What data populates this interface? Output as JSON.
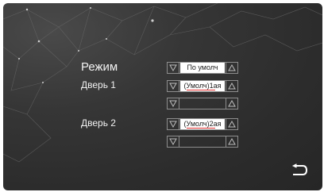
{
  "settings": {
    "mode_label": "Режим",
    "mode_value": "По умолч",
    "door1_label": "Дверь 1",
    "door1_value": "(Умолч)1ая",
    "door1_extra_value": "",
    "door2_label": "Дверь 2",
    "door2_value": "(Умолч)2ая",
    "door2_extra_value": ""
  },
  "icons": {
    "decrease": "triangle-down-icon",
    "increase": "triangle-up-icon",
    "back": "return-arrow-icon"
  },
  "colors": {
    "background": "#2e2e2e",
    "text": "#f2f2f2",
    "value_bg": "#ffffff",
    "underline": "#e23030",
    "border": "#8e8e8e"
  }
}
